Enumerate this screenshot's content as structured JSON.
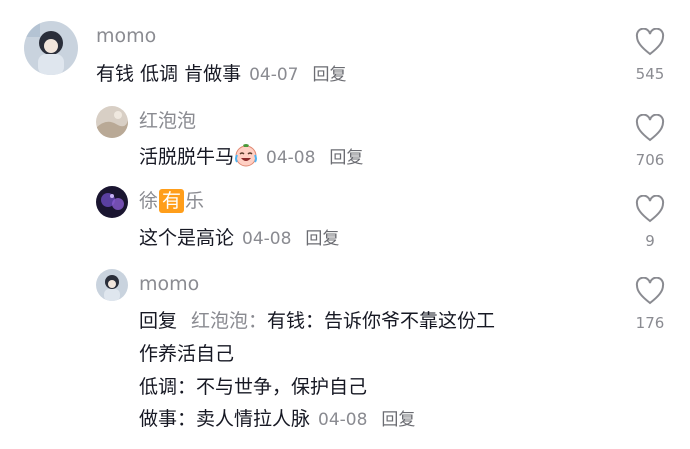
{
  "comments": [
    {
      "user": "momo",
      "text": "有钱 低调 肯做事",
      "date": "04-07",
      "reply_label": "回复",
      "likes": "545"
    },
    {
      "user": "红泡泡",
      "text": "活脱脱牛马",
      "emoji": "crying-laughing-emoji-icon",
      "date": "04-08",
      "reply_label": "回复",
      "likes": "706"
    },
    {
      "user_part1": "徐",
      "user_badge": "有",
      "user_part2": "乐",
      "text": "这个是高论",
      "date": "04-08",
      "reply_label": "回复",
      "likes": "9"
    },
    {
      "user": "momo",
      "reply_prefix": "回复",
      "reply_to": "红泡泡：",
      "lines": [
        "有钱：告诉你爷不靠这份工",
        "作养活自己",
        "低调：不与世争，保护自己",
        "做事：卖人情拉人脉"
      ],
      "date": "04-08",
      "reply_label": "回复",
      "likes": "176"
    }
  ],
  "colors": {
    "text": "#161823",
    "meta": "#8a8b91",
    "badge": "#ff9e1b"
  }
}
